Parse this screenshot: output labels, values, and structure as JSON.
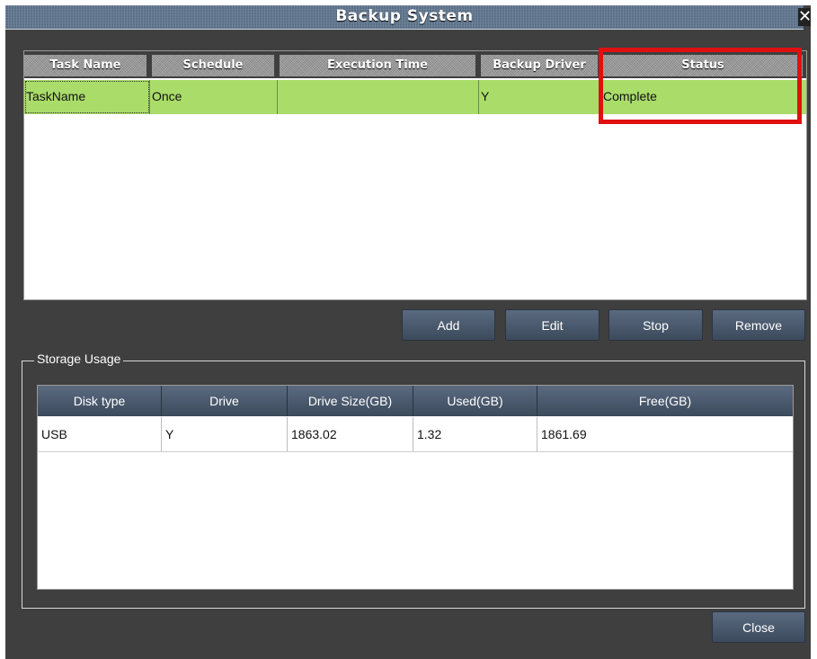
{
  "window": {
    "title": "Backup System",
    "close_glyph": "✕"
  },
  "tasks": {
    "columns": [
      "Task Name",
      "Schedule",
      "Execution Time",
      "Backup Driver",
      "Status"
    ],
    "rows": [
      {
        "task_name": "TaskName",
        "schedule": "Once",
        "execution_time": "",
        "backup_driver": "Y",
        "status": "Complete"
      }
    ]
  },
  "actions": {
    "add": "Add",
    "edit": "Edit",
    "stop": "Stop",
    "remove": "Remove"
  },
  "storage": {
    "label": "Storage Usage",
    "columns": [
      "Disk type",
      "Drive",
      "Drive Size(GB)",
      "Used(GB)",
      "Free(GB)"
    ],
    "rows": [
      {
        "disk_type": "USB",
        "drive": "Y",
        "drive_size": "1863.02",
        "used": "1.32",
        "free": "1861.69"
      }
    ]
  },
  "footer": {
    "close": "Close"
  },
  "colors": {
    "row_selected": "#aadc6a",
    "highlight": "#e01010",
    "button": "#4a586c"
  }
}
